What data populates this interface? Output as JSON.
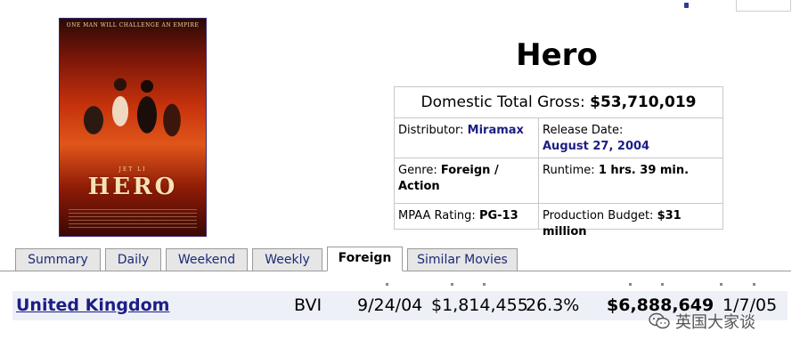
{
  "poster": {
    "tagline": "ONE MAN WILL CHALLENGE AN EMPIRE",
    "star": "JET LI",
    "title": "HERO"
  },
  "movie": {
    "title": "Hero"
  },
  "info": {
    "gross_label": "Domestic Total Gross:",
    "gross_value": "$53,710,019",
    "distributor_label": "Distributor:",
    "distributor_value": "Miramax",
    "release_label": "Release Date:",
    "release_value": "August 27, 2004",
    "genre_label": "Genre:",
    "genre_value": "Foreign / Action",
    "runtime_label": "Runtime:",
    "runtime_value": "1 hrs. 39 min.",
    "rating_label": "MPAA Rating:",
    "rating_value": "PG-13",
    "budget_label": "Production Budget:",
    "budget_value": "$31 million"
  },
  "tabs": [
    "Summary",
    "Daily",
    "Weekend",
    "Weekly",
    "Foreign",
    "Similar Movies"
  ],
  "active_tab": "Foreign",
  "foreign_row": {
    "country": "United Kingdom",
    "distributor": "BVI",
    "release": "9/24/04",
    "opening": "$1,814,455",
    "percent": "26.3%",
    "total": "$6,888,649",
    "as_of": "1/7/05"
  },
  "watermark": {
    "text": "英国大家谈",
    "icon": "wechat-icon"
  }
}
